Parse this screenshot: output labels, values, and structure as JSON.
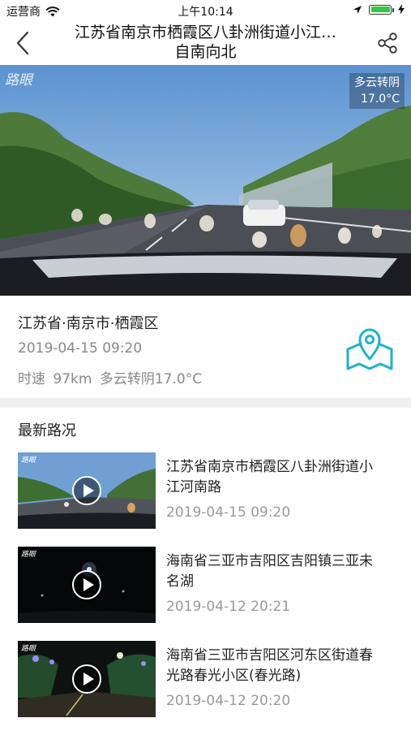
{
  "status": {
    "carrier": "运营商",
    "time": "上午10:14"
  },
  "nav": {
    "title_line1": "江苏省南京市栖霞区八卦洲街道小江…",
    "title_line2": "自南向北"
  },
  "video": {
    "watermark": "路眼",
    "weather_line1": "多云转阴",
    "weather_line2": "17.0°C"
  },
  "info": {
    "location": "江苏省·南京市·栖霞区",
    "datetime": "2019-04-15 09:20",
    "speed_weather": "时速 97km   多云转阴17.0°C"
  },
  "section_title": "最新路况",
  "items": [
    {
      "title": "江苏省南京市栖霞区八卦洲街道小江河南路",
      "time": "2019-04-15 09:20",
      "mark": "路眼"
    },
    {
      "title": "海南省三亚市吉阳区吉阳镇三亚未名湖",
      "time": "2019-04-12 20:21",
      "mark": "路眼"
    },
    {
      "title": "海南省三亚市吉阳区河东区街道春光路春光小区(春光路)",
      "time": "2019-04-12 20:20",
      "mark": "路眼"
    }
  ],
  "colors": {
    "accent": "#1fb3c8",
    "battery": "#2ecc40"
  },
  "icons": [
    "wifi-icon",
    "location-arrow-icon",
    "battery-icon",
    "charging-icon",
    "back-icon",
    "share-icon",
    "map-pin-icon",
    "play-icon"
  ]
}
